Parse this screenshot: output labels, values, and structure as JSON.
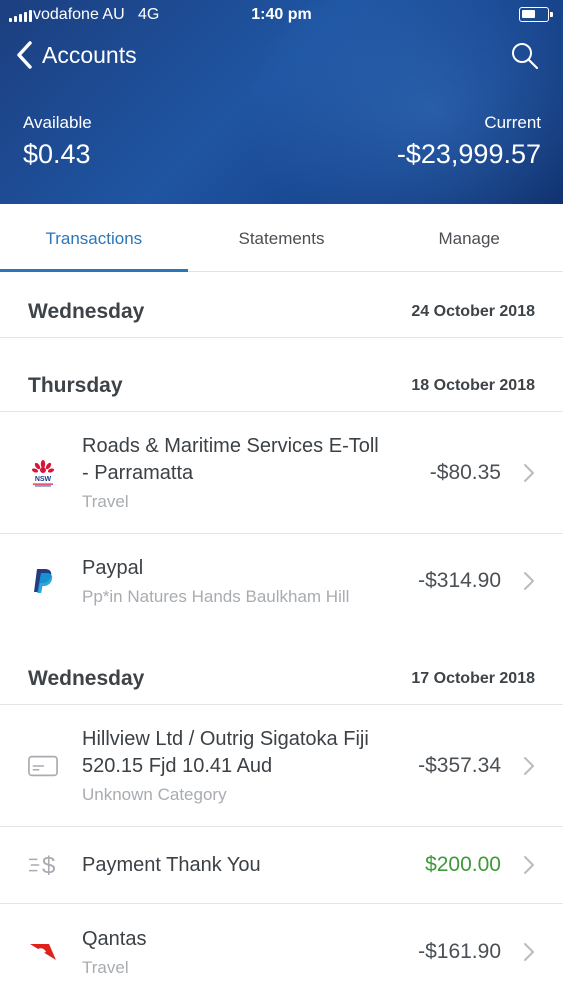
{
  "status": {
    "carrier": "vodafone AU",
    "network": "4G",
    "time": "1:40 pm"
  },
  "nav": {
    "back_label": "Accounts"
  },
  "balances": {
    "available_label": "Available",
    "available_value": "$0.43",
    "current_label": "Current",
    "current_value": "-$23,999.57"
  },
  "tabs": [
    {
      "label": "Transactions",
      "active": true
    },
    {
      "label": "Statements",
      "active": false
    },
    {
      "label": "Manage",
      "active": false
    }
  ],
  "days": [
    {
      "name": "Wednesday",
      "date": "24 October 2018",
      "transactions": []
    },
    {
      "name": "Thursday",
      "date": "18 October 2018",
      "transactions": [
        {
          "title_line1": "Roads & Maritime Services E-Toll",
          "title_line2": "- Parramatta",
          "subtitle": "Travel",
          "amount": "-$80.35",
          "icon": "nsw-logo-icon",
          "logo_text": "NSW"
        },
        {
          "title_line1": "Paypal",
          "title_line2": "",
          "subtitle": "Pp*in Natures Hands Baulkham Hill",
          "amount": "-$314.90",
          "icon": "paypal-icon"
        }
      ]
    },
    {
      "name": "Wednesday",
      "date": "17 October 2018",
      "transactions": [
        {
          "title_line1": "Hillview Ltd / Outrig Sigatoka Fiji",
          "title_line2": "520.15 Fjd 10.41 Aud",
          "subtitle": "Unknown Category",
          "amount": "-$357.34",
          "icon": "card-icon"
        },
        {
          "title_line1": "Payment Thank You",
          "title_line2": "",
          "subtitle": "",
          "amount": "$200.00",
          "icon": "payment-dollar-icon"
        },
        {
          "title_line1": "Qantas",
          "title_line2": "",
          "subtitle": "Travel",
          "amount": "-$161.90",
          "icon": "qantas-icon"
        }
      ]
    }
  ],
  "colors": {
    "header": "#1f55a2",
    "accent": "#2a76b8",
    "positive": "#3f9a3a",
    "nsw_red": "#d7153a",
    "paypal_dark": "#253b80",
    "paypal_light": "#179bd7",
    "qantas_red": "#e0201b"
  }
}
